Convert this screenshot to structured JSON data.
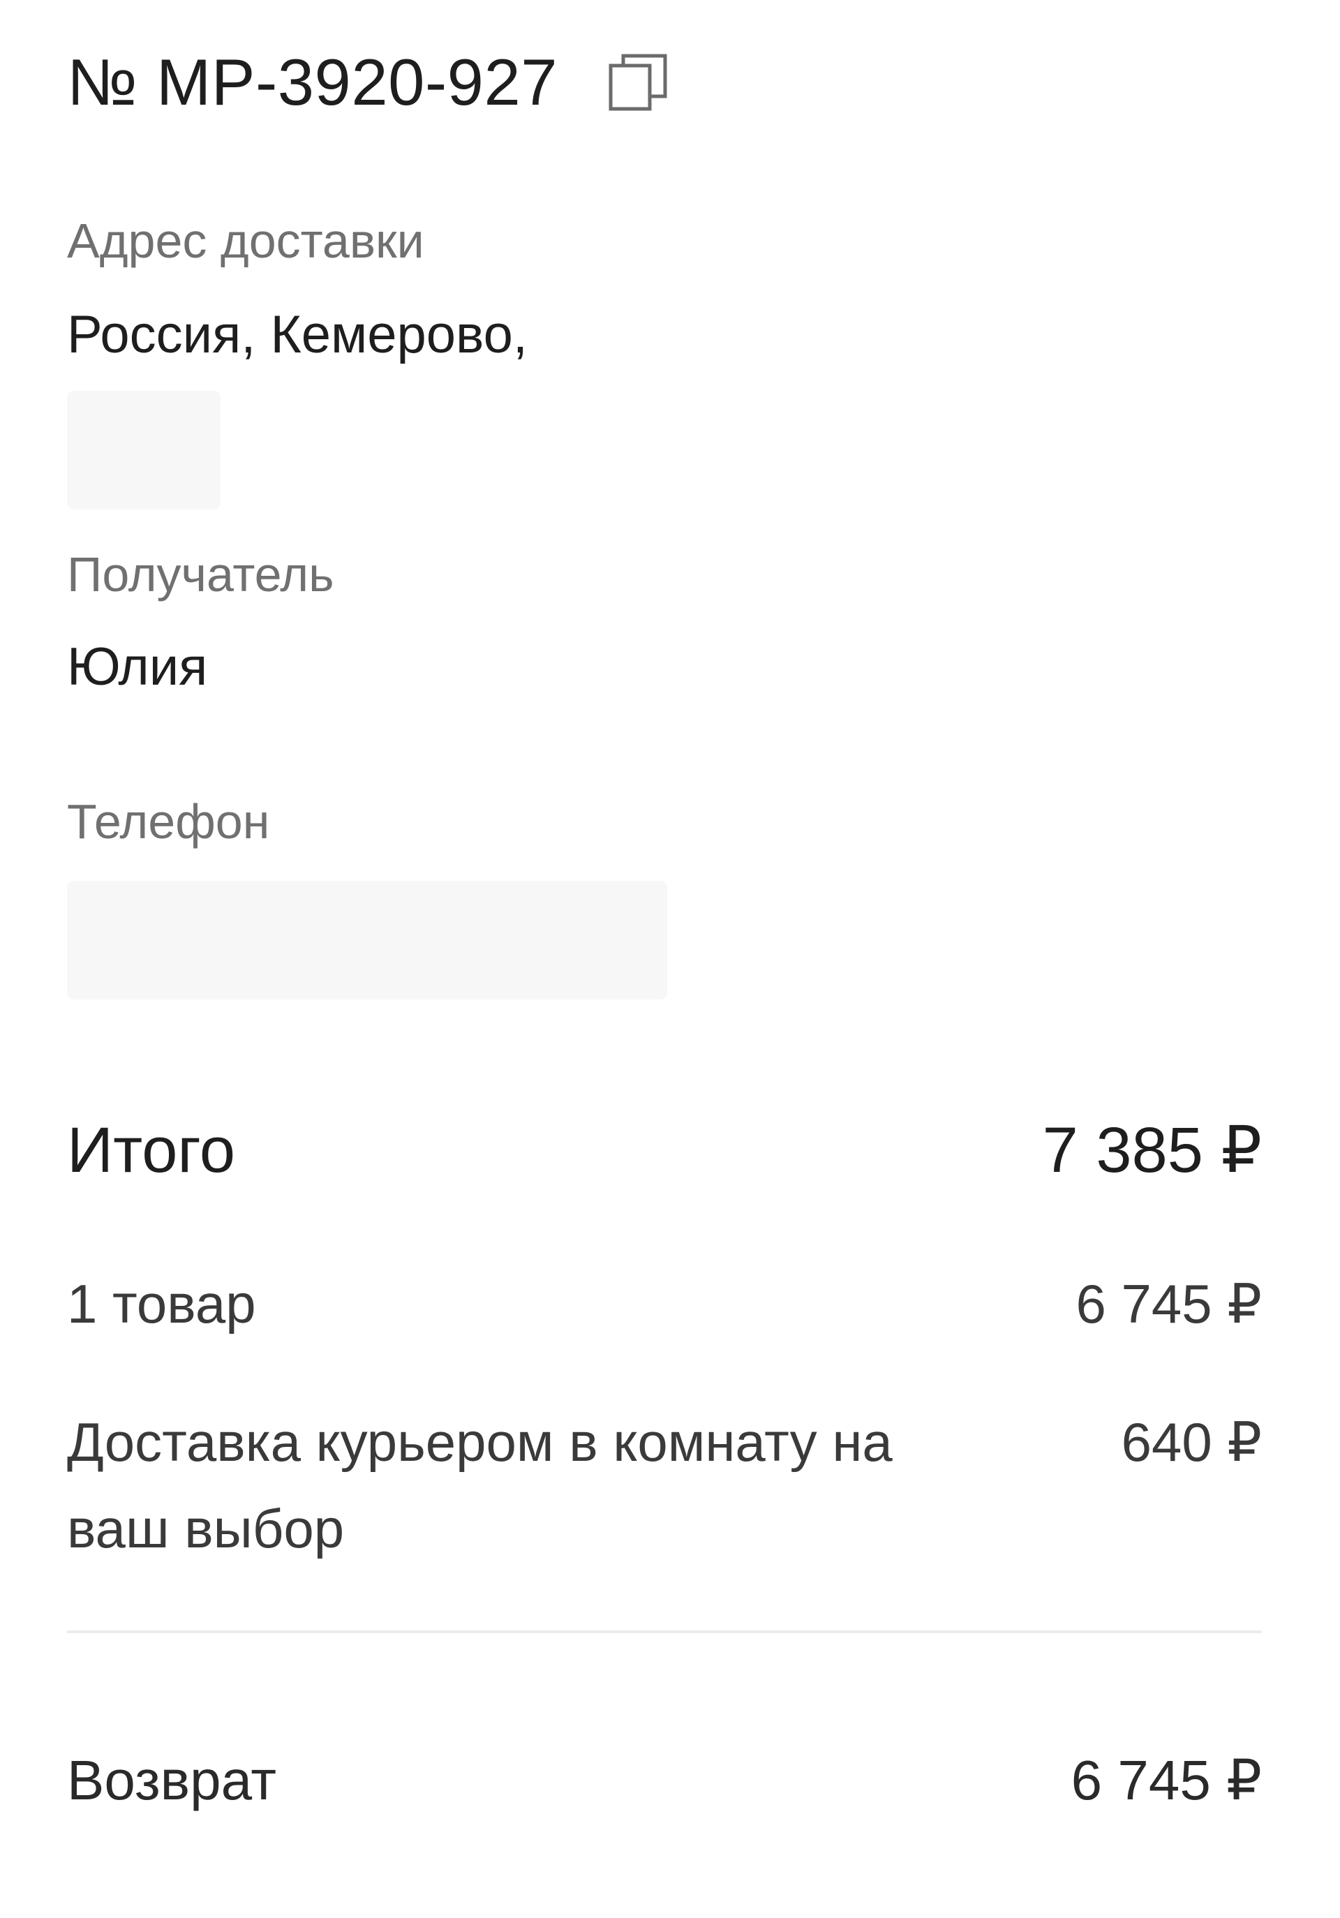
{
  "order": {
    "number": "№ MP-3920-927",
    "copy_icon": "copy-icon"
  },
  "delivery_address": {
    "label": "Адрес доставки",
    "value": "Россия, Кемерово,"
  },
  "recipient": {
    "label": "Получатель",
    "value": "Юлия"
  },
  "phone": {
    "label": "Телефон"
  },
  "summary": {
    "total_label": "Итого",
    "total_value": "7 385 ₽",
    "items_label": "1 товар",
    "items_value": "6 745 ₽",
    "delivery_label": "Доставка курьером в комнату на ваш выбор",
    "delivery_value": "640 ₽",
    "refund_label": "Возврат",
    "refund_value": "6 745 ₽"
  },
  "colors": {
    "text_primary": "#1e1e1e",
    "text_secondary": "#707070",
    "divider": "#ececec",
    "background": "#ffffff"
  }
}
